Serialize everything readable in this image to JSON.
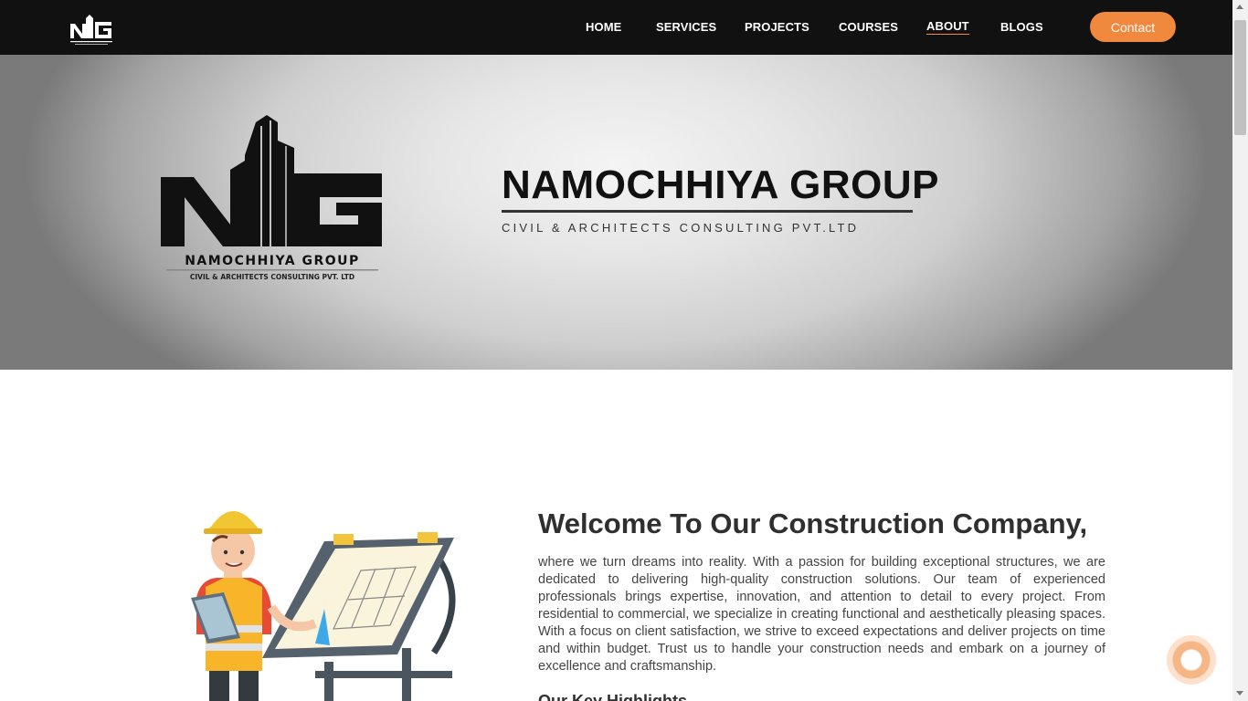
{
  "brand": {
    "logo_name": "NAMOCHHIYA GROUP",
    "logo_tagline": "CIVIL & ARCHITECTS CONSULTING PVT. LTD",
    "accent_color": "#f0883e"
  },
  "nav": {
    "items": [
      {
        "label": "HOME"
      },
      {
        "label": "SERVICES"
      },
      {
        "label": "PROJECTS"
      },
      {
        "label": "COURSES"
      },
      {
        "label": "ABOUT",
        "active": true
      },
      {
        "label": "BLOGS"
      }
    ],
    "contact_label": "Contact"
  },
  "hero": {
    "title": "NAMOCHHIYA GROUP",
    "subtitle": "CIVIL & ARCHITECTS CONSULTING PVT.LTD"
  },
  "welcome": {
    "title": "Welcome To Our Construction Company,",
    "body": "where we turn dreams into reality. With a passion for building exceptional structures, we are dedicated to delivering high-quality construction solutions. Our team of experienced professionals brings expertise, innovation, and attention to detail to every project. From residential to commercial, we specialize in creating functional and aesthetically pleasing spaces. With a focus on client satisfaction, we strive to exceed expectations and deliver projects on time and within budget. Trust us to handle your construction needs and embark on a journey of excellence and craftsmanship.",
    "highlights_title": "Our Key Highlights"
  },
  "icons": {
    "chat": "chat-bubble-icon",
    "illustration": "engineer-blueprint-illustration"
  }
}
